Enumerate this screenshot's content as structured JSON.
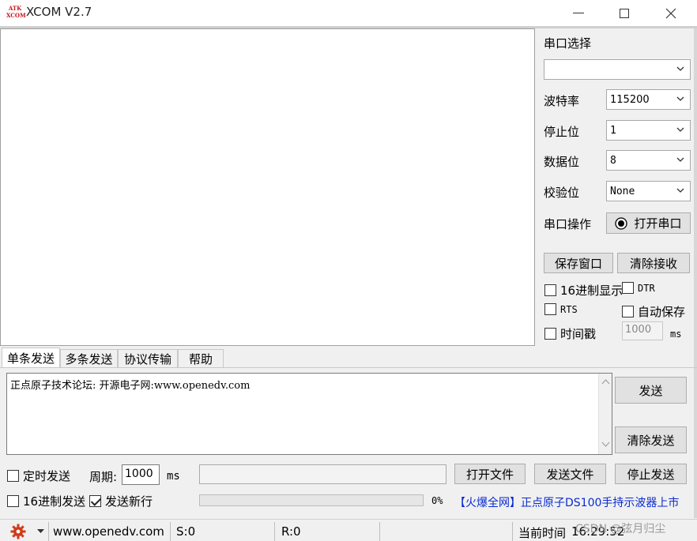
{
  "window": {
    "logo_text": "ATK\nXCOM",
    "title": "XCOM V2.7",
    "minimize": "—",
    "maximize": "☐",
    "close": "✕"
  },
  "serial": {
    "port_label": "串口选择",
    "port_value": "",
    "baud_label": "波特率",
    "baud_value": "115200",
    "stop_label": "停止位",
    "stop_value": "1",
    "data_label": "数据位",
    "data_value": "8",
    "parity_label": "校验位",
    "parity_value": "None",
    "op_label": "串口操作",
    "open_button": "打开串口"
  },
  "receive": {
    "save_window": "保存窗口",
    "clear_receive": "清除接收",
    "hex_display": "16进制显示",
    "dtr": "DTR",
    "rts": "RTS",
    "auto_save": "自动保存",
    "timestamp": "时间戳",
    "timestamp_value": "1000",
    "timestamp_unit": "ms"
  },
  "tabs": [
    "单条发送",
    "多条发送",
    "协议传输",
    "帮助"
  ],
  "send": {
    "text": "正点原子技术论坛: 开源电子网:www.openedv.com",
    "send_button": "发送",
    "clear_send": "清除发送",
    "timed_send": "定时发送",
    "period_label": "周期:",
    "period_value": "1000",
    "period_unit": "ms",
    "open_file": "打开文件",
    "send_file": "发送文件",
    "stop_send": "停止发送",
    "hex_send": "16进制发送",
    "send_newline": "发送新行",
    "progress": "0%",
    "ad": "【火爆全网】正点原子DS100手持示波器上市"
  },
  "status": {
    "url": "www.openedv.com",
    "s": "S:0",
    "r": "R:0",
    "time_label": "当前时间",
    "time_value": "16:29:52",
    "watermark": "CSDN @弦月归尘"
  },
  "colors": {
    "accent": "#0a2bd1",
    "logo": "#c8141e",
    "gear": "#d03a1a"
  }
}
